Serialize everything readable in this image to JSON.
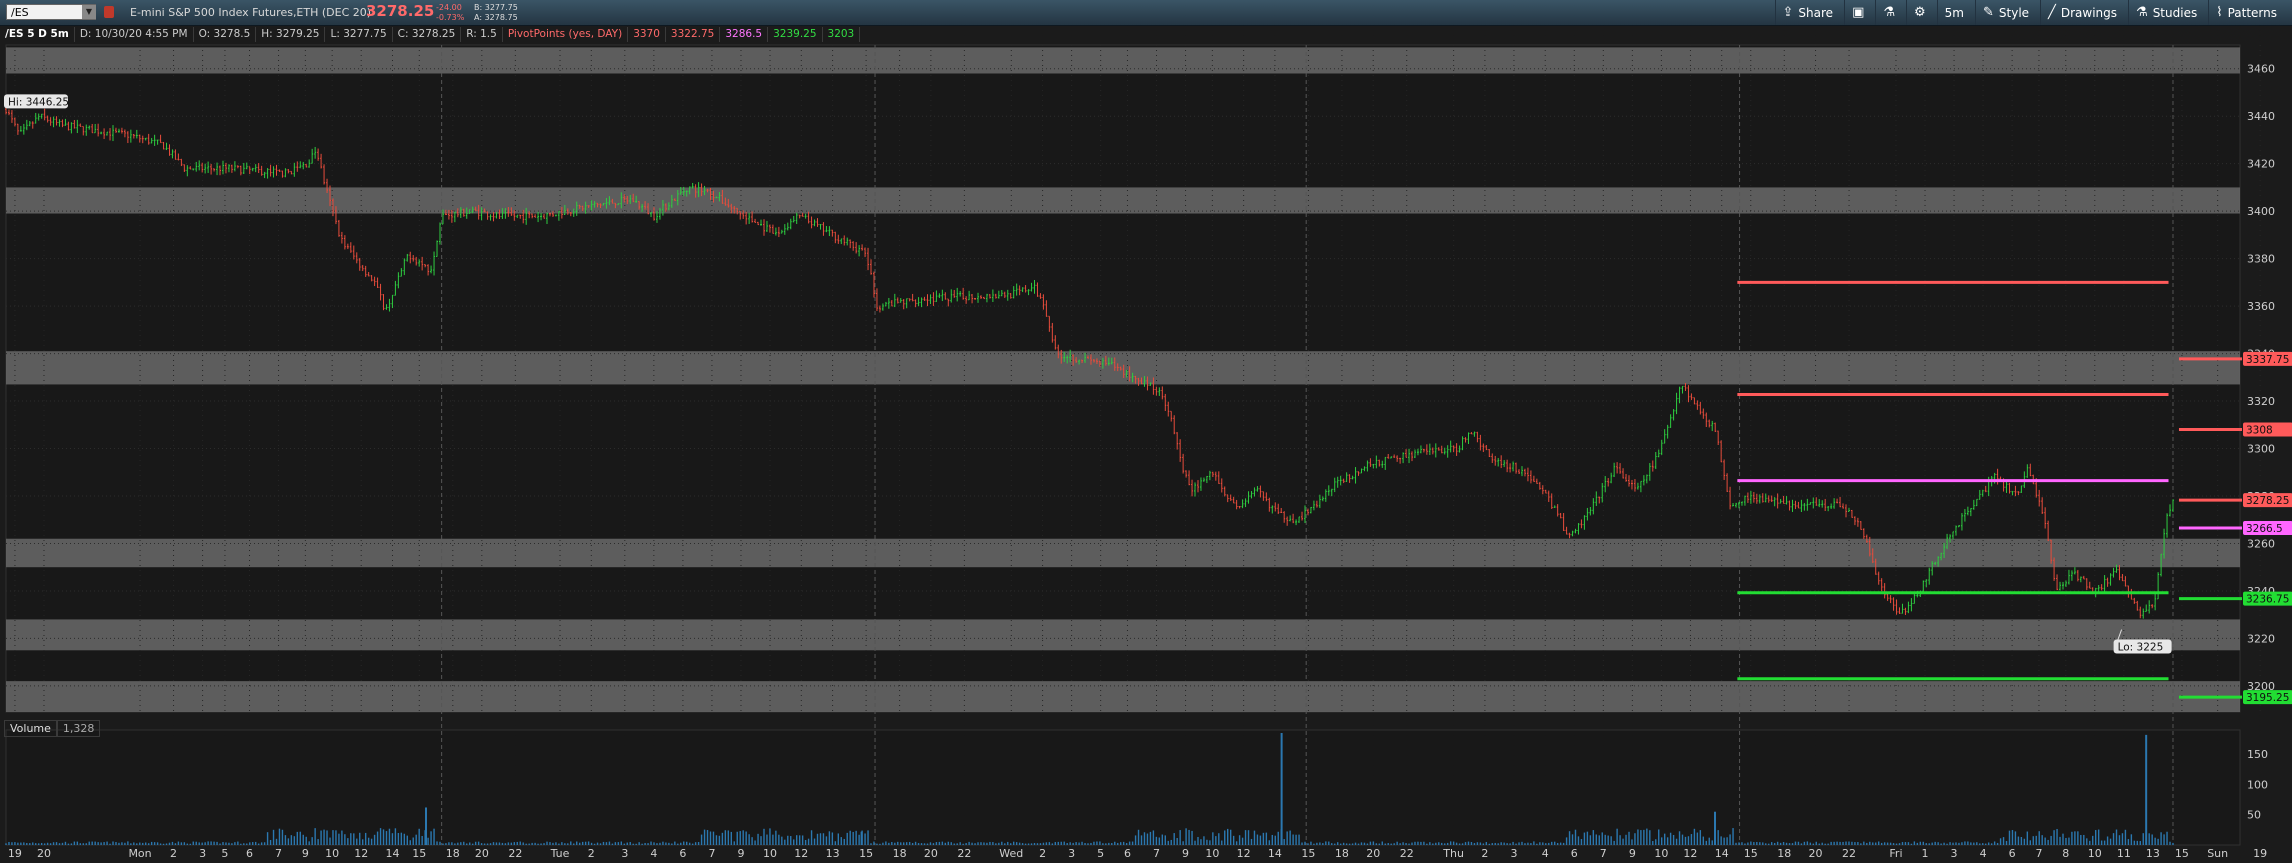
{
  "toolbar": {
    "symbol": "/ES",
    "description": "E-mini S&P 500 Index Futures,ETH (DEC 20)",
    "last_price": "3278.25",
    "change": "-24.00",
    "change_pct": "-0.73%",
    "bid": "B: 3277.75",
    "ask": "A: 3278.75",
    "buttons": {
      "share": "Share",
      "timeframe": "5m",
      "style": "Style",
      "drawings": "Drawings",
      "studies": "Studies",
      "patterns": "Patterns"
    }
  },
  "legend": {
    "chart_label": "/ES 5 D 5m",
    "date": "D: 10/30/20 4:55 PM",
    "open": "O: 3278.5",
    "high": "H: 3279.25",
    "low": "L: 3277.75",
    "close": "C: 3278.25",
    "range": "R: 1.5",
    "study": "PivotPoints (yes, DAY)",
    "pivots": [
      "3370",
      "3322.75",
      "3286.5",
      "3239.25",
      "3203"
    ]
  },
  "volume": {
    "label": "Volume",
    "value": "1,328"
  },
  "colors": {
    "background": "#1b1b1b",
    "up": "#2ecc40",
    "down": "#e74c3c",
    "resistance": "#ff5a5a",
    "pivot": "#ff66ff",
    "support": "#22dd33",
    "volume": "#2b78b0",
    "band": "#6a6a6a"
  },
  "chart_data": {
    "type": "candlestick",
    "price_ticks": [
      3460,
      3440,
      3420,
      3400,
      3380,
      3360,
      3340,
      3320,
      3300,
      3280,
      3260,
      3240,
      3220,
      3200
    ],
    "price_range": [
      3189,
      3470
    ],
    "volume_ticks": [
      150,
      100,
      50
    ],
    "volume_range": [
      0,
      190
    ],
    "x_ticks": [
      "19",
      "20",
      "Mon",
      "2",
      "3",
      "5",
      "6",
      "7",
      "9",
      "10",
      "12",
      "14",
      "15",
      "18",
      "20",
      "22",
      "Tue",
      "2",
      "3",
      "4",
      "6",
      "7",
      "9",
      "10",
      "12",
      "13",
      "15",
      "18",
      "20",
      "22",
      "Wed",
      "2",
      "3",
      "5",
      "6",
      "7",
      "9",
      "10",
      "12",
      "14",
      "15",
      "18",
      "20",
      "22",
      "Thu",
      "2",
      "3",
      "4",
      "6",
      "7",
      "9",
      "10",
      "12",
      "14",
      "15",
      "18",
      "20",
      "22",
      "Fri",
      "1",
      "3",
      "4",
      "6",
      "7",
      "8",
      "10",
      "11",
      "13",
      "15",
      "Sun",
      "19"
    ],
    "x_tick_pos": [
      0.004,
      0.017,
      0.06,
      0.075,
      0.088,
      0.098,
      0.109,
      0.122,
      0.134,
      0.146,
      0.159,
      0.173,
      0.185,
      0.2,
      0.213,
      0.228,
      0.248,
      0.262,
      0.277,
      0.29,
      0.303,
      0.316,
      0.329,
      0.342,
      0.356,
      0.37,
      0.385,
      0.4,
      0.414,
      0.429,
      0.45,
      0.464,
      0.477,
      0.49,
      0.502,
      0.515,
      0.528,
      0.54,
      0.554,
      0.568,
      0.583,
      0.598,
      0.612,
      0.627,
      0.648,
      0.662,
      0.675,
      0.689,
      0.702,
      0.715,
      0.728,
      0.741,
      0.754,
      0.768,
      0.781,
      0.796,
      0.81,
      0.825,
      0.846,
      0.859,
      0.872,
      0.885,
      0.898,
      0.91,
      0.922,
      0.935,
      0.948,
      0.961,
      0.974,
      0.99,
      1.009
    ],
    "session_dividers": [
      0.195,
      0.389,
      0.582,
      0.776,
      0.97
    ],
    "price_path": [
      [
        0.0,
        3443
      ],
      [
        0.006,
        3432
      ],
      [
        0.015,
        3440
      ],
      [
        0.025,
        3436
      ],
      [
        0.04,
        3434
      ],
      [
        0.055,
        3432
      ],
      [
        0.07,
        3428
      ],
      [
        0.08,
        3418
      ],
      [
        0.1,
        3418
      ],
      [
        0.125,
        3416
      ],
      [
        0.135,
        3420
      ],
      [
        0.139,
        3426
      ],
      [
        0.143,
        3410
      ],
      [
        0.15,
        3388
      ],
      [
        0.158,
        3378
      ],
      [
        0.165,
        3370
      ],
      [
        0.17,
        3358
      ],
      [
        0.18,
        3382
      ],
      [
        0.19,
        3375
      ],
      [
        0.195,
        3398
      ],
      [
        0.21,
        3400
      ],
      [
        0.22,
        3398
      ],
      [
        0.24,
        3398
      ],
      [
        0.26,
        3402
      ],
      [
        0.28,
        3405
      ],
      [
        0.29,
        3398
      ],
      [
        0.305,
        3410
      ],
      [
        0.315,
        3408
      ],
      [
        0.33,
        3398
      ],
      [
        0.345,
        3390
      ],
      [
        0.355,
        3398
      ],
      [
        0.37,
        3390
      ],
      [
        0.385,
        3382
      ],
      [
        0.39,
        3360
      ],
      [
        0.41,
        3363
      ],
      [
        0.43,
        3364
      ],
      [
        0.45,
        3365
      ],
      [
        0.46,
        3368
      ],
      [
        0.465,
        3360
      ],
      [
        0.47,
        3340
      ],
      [
        0.48,
        3338
      ],
      [
        0.495,
        3335
      ],
      [
        0.505,
        3330
      ],
      [
        0.515,
        3325
      ],
      [
        0.52,
        3318
      ],
      [
        0.525,
        3298
      ],
      [
        0.53,
        3282
      ],
      [
        0.54,
        3290
      ],
      [
        0.55,
        3275
      ],
      [
        0.56,
        3282
      ],
      [
        0.57,
        3272
      ],
      [
        0.578,
        3270
      ],
      [
        0.585,
        3275
      ],
      [
        0.595,
        3285
      ],
      [
        0.61,
        3293
      ],
      [
        0.63,
        3298
      ],
      [
        0.65,
        3300
      ],
      [
        0.655,
        3308
      ],
      [
        0.665,
        3296
      ],
      [
        0.68,
        3290
      ],
      [
        0.69,
        3280
      ],
      [
        0.7,
        3262
      ],
      [
        0.71,
        3275
      ],
      [
        0.72,
        3292
      ],
      [
        0.73,
        3282
      ],
      [
        0.74,
        3298
      ],
      [
        0.75,
        3328
      ],
      [
        0.755,
        3320
      ],
      [
        0.765,
        3308
      ],
      [
        0.772,
        3276
      ],
      [
        0.78,
        3280
      ],
      [
        0.8,
        3276
      ],
      [
        0.82,
        3277
      ],
      [
        0.83,
        3268
      ],
      [
        0.84,
        3240
      ],
      [
        0.848,
        3230
      ],
      [
        0.855,
        3238
      ],
      [
        0.865,
        3255
      ],
      [
        0.875,
        3270
      ],
      [
        0.885,
        3282
      ],
      [
        0.89,
        3288
      ],
      [
        0.9,
        3280
      ],
      [
        0.905,
        3292
      ],
      [
        0.912,
        3272
      ],
      [
        0.918,
        3240
      ],
      [
        0.925,
        3248
      ],
      [
        0.935,
        3240
      ],
      [
        0.945,
        3248
      ],
      [
        0.955,
        3230
      ],
      [
        0.962,
        3236
      ],
      [
        0.967,
        3272
      ],
      [
        0.97,
        3278
      ]
    ],
    "bands": [
      [
        3458,
        3469
      ],
      [
        3399,
        3410
      ],
      [
        3327,
        3341
      ],
      [
        3250,
        3262
      ],
      [
        3215,
        3228
      ],
      [
        3189,
        3202
      ]
    ],
    "pivot_lines": [
      {
        "price": 3370,
        "color": "#ff5a5a"
      },
      {
        "price": 3322.75,
        "color": "#ff5a5a"
      },
      {
        "price": 3286.5,
        "color": "#ff66ff"
      },
      {
        "price": 3239.25,
        "color": "#22dd33"
      },
      {
        "price": 3203,
        "color": "#22dd33"
      }
    ],
    "pivot_x_range": [
      0.775,
      0.968
    ],
    "right_labels": [
      {
        "text": "3337.75",
        "price": 3337.75,
        "color": "#ff5a5a"
      },
      {
        "text": "3308",
        "price": 3308,
        "color": "#ff5a5a"
      },
      {
        "text": "3278.25",
        "price": 3278.25,
        "color": "#ff5a5a"
      },
      {
        "text": "3266.5",
        "price": 3266.5,
        "color": "#ff66ff"
      },
      {
        "text": "3236.75",
        "price": 3236.75,
        "color": "#22dd33"
      },
      {
        "text": "3195.25",
        "price": 3195.25,
        "color": "#22dd33"
      }
    ],
    "hi_label": "Hi: 3446.25",
    "lo_label": "Lo: 3225",
    "volume_spikes": [
      [
        0.188,
        62
      ],
      [
        0.383,
        22
      ],
      [
        0.571,
        185
      ],
      [
        0.765,
        55
      ],
      [
        0.958,
        182
      ]
    ]
  }
}
